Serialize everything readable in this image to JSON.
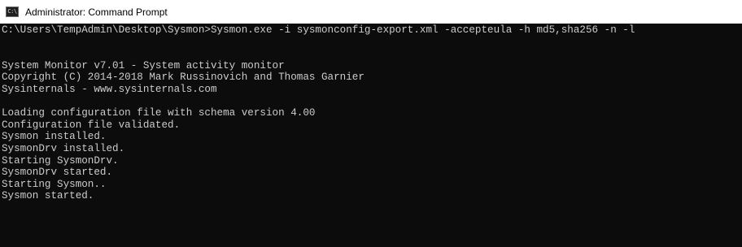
{
  "window": {
    "title": "Administrator: Command Prompt",
    "icon": "cmd-icon",
    "icon_glyph": "C:\\",
    "background": "#0c0c0c",
    "text_color": "#cccccc"
  },
  "console": {
    "command_line": "C:\\Users\\TempAdmin\\Desktop\\Sysmon>Sysmon.exe -i sysmonconfig-export.xml -accepteula -h md5,sha256 -n -l",
    "banner": [
      "System Monitor v7.01 - System activity monitor",
      "Copyright (C) 2014-2018 Mark Russinovich and Thomas Garnier",
      "Sysinternals - www.sysinternals.com"
    ],
    "output": [
      "Loading configuration file with schema version 4.00",
      "Configuration file validated.",
      "Sysmon installed.",
      "SysmonDrv installed.",
      "Starting SysmonDrv.",
      "SysmonDrv started.",
      "Starting Sysmon..",
      "Sysmon started."
    ]
  }
}
